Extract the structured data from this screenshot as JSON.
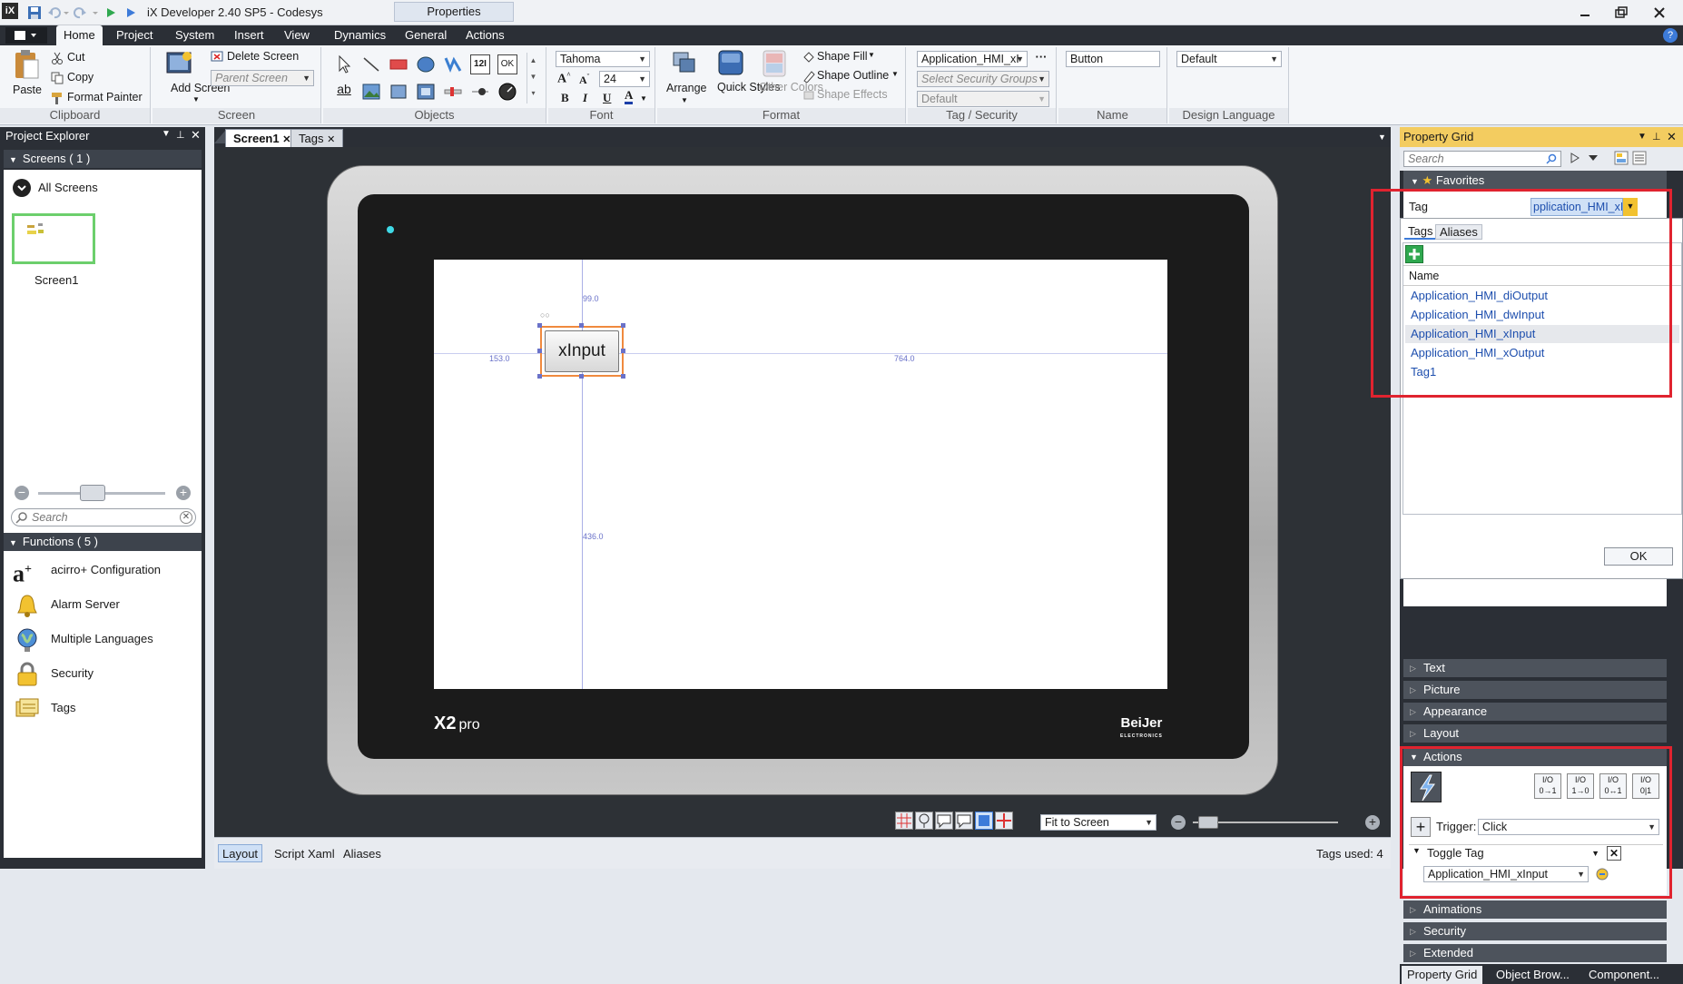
{
  "window": {
    "title": "iX Developer 2.40 SP5 - Codesys",
    "context_tab": "Properties",
    "app_icon": "iX"
  },
  "ribbon_tabs": [
    "Home",
    "Project",
    "System",
    "Insert",
    "View",
    "Dynamics",
    "General",
    "Actions"
  ],
  "ribbon": {
    "clipboard": {
      "paste": "Paste",
      "cut": "Cut",
      "copy": "Copy",
      "format_painter": "Format Painter",
      "label": "Clipboard"
    },
    "screen": {
      "add_screen": "Add Screen",
      "delete_screen": "Delete Screen",
      "parent_screen": "Parent Screen",
      "label": "Screen"
    },
    "objects": {
      "label": "Objects",
      "text_12": "12I",
      "text_ok": "OK",
      "text_ab": "ab"
    },
    "font": {
      "family": "Tahoma",
      "size": "24",
      "label": "Font"
    },
    "format": {
      "arrange": "Arrange",
      "quick_styles": "Quick Styles",
      "other_colors": "Other Colors",
      "shape_fill": "Shape Fill",
      "shape_outline": "Shape Outline",
      "shape_effects": "Shape Effects",
      "label": "Format"
    },
    "tag_security": {
      "tag_value": "Application_HMI_xI",
      "security_placeholder": "Select Security Groups",
      "default": "Default",
      "label": "Tag / Security"
    },
    "name": {
      "value": "Button",
      "label": "Name"
    },
    "design_language": {
      "value": "Default",
      "label": "Design Language"
    }
  },
  "project_explorer": {
    "title": "Project Explorer",
    "screens_header": "Screens ( 1 )",
    "all_screens": "All Screens",
    "screen_name": "Screen1",
    "search_placeholder": "Search",
    "functions_header": "Functions ( 5 )",
    "functions": [
      {
        "label": "acirro+ Configuration",
        "icon": "acirro-icon"
      },
      {
        "label": "Alarm Server",
        "icon": "bell-icon"
      },
      {
        "label": "Multiple Languages",
        "icon": "globe-icon"
      },
      {
        "label": "Security",
        "icon": "lock-icon"
      },
      {
        "label": "Tags",
        "icon": "tags-icon"
      }
    ]
  },
  "doc_tabs": [
    "Screen1",
    "Tags"
  ],
  "canvas": {
    "button_label": "xInput",
    "guide_top": "99.0",
    "guide_left": "153.0",
    "guide_right": "764.0",
    "guide_bottom": "436.0",
    "brand_model": "X2",
    "brand_model_suffix": "pro",
    "brand_maker": "BeiJer",
    "brand_maker_sub": "ELECTRONICS",
    "zoom_mode": "Fit to Screen"
  },
  "status_bar": {
    "tabs": [
      "Layout",
      "Script",
      "Xaml",
      "Aliases"
    ],
    "tags_used": "Tags used: 4"
  },
  "property_grid": {
    "title": "Property Grid",
    "search_placeholder": "Search",
    "favorites": "Favorites",
    "tag_label": "Tag",
    "tag_value": "pplication_HMI_xInput",
    "popup_tabs": [
      "Tags",
      "Aliases"
    ],
    "column_name": "Name",
    "tags": [
      "Application_HMI_diOutput",
      "Application_HMI_dwInput",
      "Application_HMI_xInput",
      "Application_HMI_xOutput",
      "Tag1"
    ],
    "selected_tag_index": 2,
    "ok": "OK",
    "categories_above": [
      "Text",
      "Picture",
      "Appearance",
      "Layout"
    ],
    "actions": "Actions",
    "trigger_label": "Trigger:",
    "trigger_value": "Click",
    "action_name": "Toggle Tag",
    "action_tag": "Application_HMI_xInput",
    "categories_below": [
      "Animations",
      "Security",
      "Extended"
    ],
    "bottom_tabs": [
      "Property Grid",
      "Object Brow...",
      "Component..."
    ]
  },
  "colors": {
    "highlight_red": "#e0232f",
    "accent_yellow": "#f3cc60",
    "link_blue": "#1e4fae",
    "selection_orange": "#f08a3e"
  }
}
